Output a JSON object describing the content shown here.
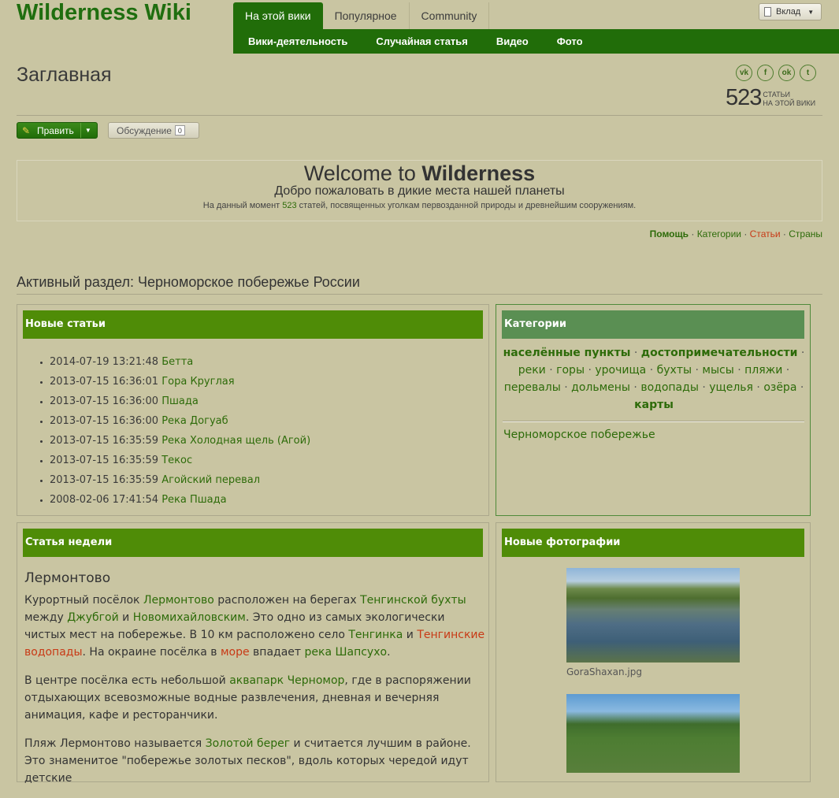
{
  "header": {
    "wiki_title": "Wilderness Wiki",
    "tabs": [
      "На этой вики",
      "Популярное",
      "Community"
    ],
    "subnav": [
      "Вики-деятельность",
      "Случайная статья",
      "Видео",
      "Фото"
    ],
    "contribute": "Вклад"
  },
  "page": {
    "title": "Заглавная",
    "social": [
      "vk-icon",
      "facebook-icon",
      "odnoklassniki-icon",
      "twitter-icon"
    ],
    "article_count": "523",
    "count_label1": "СТАТЬИ",
    "count_label2": "НА ЭТОЙ ВИКИ",
    "edit_label": "Править",
    "talk_label": "Обсуждение",
    "talk_count": "0"
  },
  "welcome": {
    "heading_prefix": "Welcome to ",
    "heading_bold": "Wilderness",
    "subtitle": "Добро пожаловать в дикие места нашей планеты",
    "small_before": "На данный момент ",
    "small_count": "523",
    "small_after": " статей, посвященных уголкам первозданной природы и древнейшим сооружениям."
  },
  "quicklinks": {
    "help": "Помощь",
    "categories": "Категории",
    "articles": "Статьи",
    "countries": "Страны",
    "sep": " · "
  },
  "active_section": "Активный раздел: Черноморское побережье России",
  "new_articles": {
    "title": "Новые статьи",
    "items": [
      {
        "date": "2014-07-19 13:21:48",
        "name": "Бетта"
      },
      {
        "date": "2013-07-15 16:36:01",
        "name": "Гора Круглая"
      },
      {
        "date": "2013-07-15 16:36:00",
        "name": "Пшада"
      },
      {
        "date": "2013-07-15 16:36:00",
        "name": "Река Догуаб"
      },
      {
        "date": "2013-07-15 16:35:59",
        "name": "Река Холодная щель (Агой)"
      },
      {
        "date": "2013-07-15 16:35:59",
        "name": "Текос"
      },
      {
        "date": "2013-07-15 16:35:59",
        "name": "Агойский перевал"
      },
      {
        "date": "2008-02-06 17:41:54",
        "name": "Река Пшада"
      }
    ]
  },
  "categories": {
    "title": "Категории",
    "bold1": "населённые пункты",
    "bold2": "достопримечательности",
    "row2": [
      "реки",
      "горы",
      "урочища",
      "бухты",
      "мысы",
      "пляжи"
    ],
    "row3": [
      "перевалы",
      "дольмены",
      "водопады",
      "ущелья",
      "озёра"
    ],
    "bold3": "карты",
    "coast": "Черноморское побережье"
  },
  "week": {
    "title": "Статья недели",
    "article": "Лермонтово",
    "p1": {
      "t1": "Курортный посёлок ",
      "l1": "Лермонтово",
      "t2": " расположен на берегах ",
      "l2": "Тенгинской бухты",
      "t3": " между ",
      "l3": "Джубгой",
      "t4": " и ",
      "l4": "Новомихайловским",
      "t5": ". Это одно из самых экологически чистых мест на побережье. В 10 км расположено село ",
      "l5": "Тенгинка",
      "t6": " и ",
      "l6": "Тенгинские водопады",
      "t7": ". На окраине посёлка в ",
      "l7": "море",
      "t8": " впадает ",
      "l8": "река Шапсухо",
      "t9": "."
    },
    "p2": {
      "t1": "В центре посёлка есть небольшой ",
      "l1": "аквапарк Черномор",
      "t2": ", где в распоряжении отдыхающих всевозможные водные развлечения, дневная и вечерняя анимация, кафе и ресторанчики."
    },
    "p3": {
      "t1": "Пляж Лермонтово называется ",
      "l1": "Золотой берег",
      "t2": " и считается лучшим в районе. Это знаменитое \"побережье золотых песков\", вдоль которых чередой идут детские"
    }
  },
  "photos": {
    "title": "Новые фотографии",
    "caption1": "GoraShaxan.jpg"
  }
}
